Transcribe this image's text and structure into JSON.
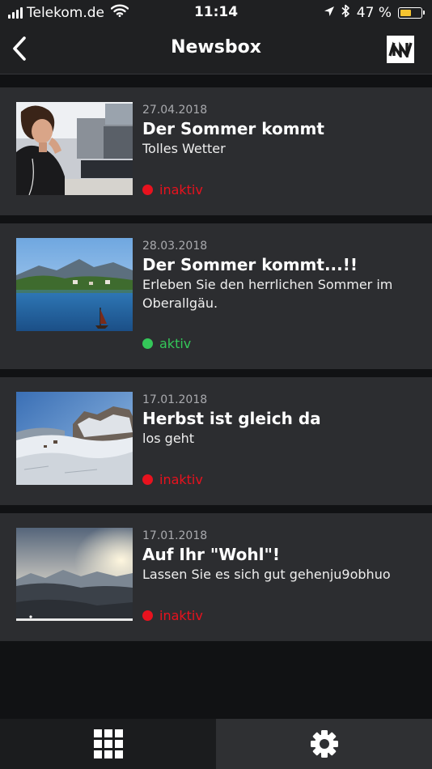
{
  "status_bar": {
    "carrier": "Telekom.de",
    "time": "11:14",
    "battery": "47 %",
    "battery_level": 0.47,
    "icons": [
      "signal-icon",
      "wifi-icon",
      "location-icon",
      "bluetooth-icon",
      "battery-icon"
    ]
  },
  "header": {
    "title": "Newsbox",
    "back_icon": "chevron-left-icon",
    "logo_text": "/W/"
  },
  "news": [
    {
      "date": "27.04.2018",
      "title": "Der Sommer kommt",
      "subtitle": "Tolles Wetter",
      "status": "inaktiv",
      "status_color": "#e8121e",
      "image": "woman-office-photo"
    },
    {
      "date": "28.03.2018",
      "title": "Der Sommer kommt...!!",
      "subtitle": "Erleben Sie den herrlichen Sommer im Oberallgäu.",
      "status": "aktiv",
      "status_color": "#34c759",
      "image": "lake-mountains-photo"
    },
    {
      "date": "17.01.2018",
      "title": "Herbst ist gleich da",
      "subtitle": "los geht",
      "status": "inaktiv",
      "status_color": "#e8121e",
      "image": "snowy-mountain-photo"
    },
    {
      "date": "17.01.2018",
      "title": "Auf Ihr \"Wohl\"!",
      "subtitle": "Lassen Sie es sich gut gehenju9obhuo",
      "status": "inaktiv",
      "status_color": "#e8121e",
      "image": "mountain-sunset-photo"
    }
  ],
  "tab_bar": {
    "tabs": [
      {
        "icon": "grid-icon"
      },
      {
        "icon": "gear-icon"
      }
    ]
  },
  "colors": {
    "background": "#111214",
    "card": "#2c2d30",
    "bar": "#1f2022",
    "active": "#34c759",
    "inactive": "#e8121e"
  }
}
